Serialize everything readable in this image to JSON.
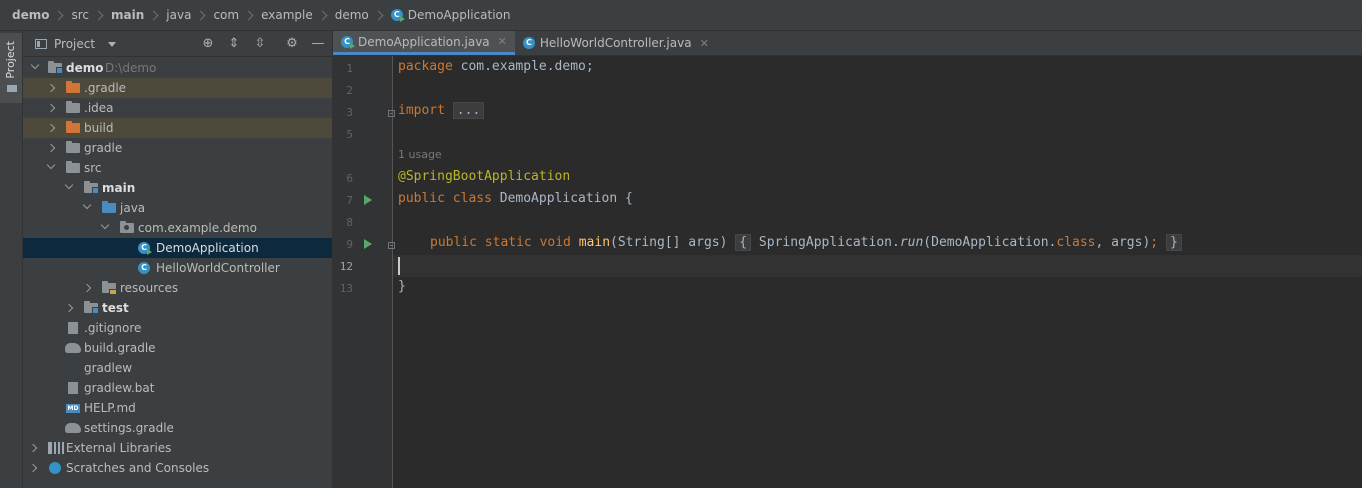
{
  "breadcrumb": [
    {
      "label": "demo",
      "bold": true
    },
    {
      "label": "src",
      "bold": false
    },
    {
      "label": "main",
      "bold": true
    },
    {
      "label": "java",
      "bold": false
    },
    {
      "label": "com",
      "bold": false
    },
    {
      "label": "example",
      "bold": false
    },
    {
      "label": "demo",
      "bold": false
    },
    {
      "label": "DemoApplication",
      "bold": false
    }
  ],
  "left_strip": {
    "label": "Project"
  },
  "project": {
    "title": "Project",
    "tree": [
      {
        "label": "demo",
        "path": "D:\\demo",
        "bold": true
      },
      {
        "label": ".gradle"
      },
      {
        "label": ".idea"
      },
      {
        "label": "build"
      },
      {
        "label": "gradle"
      },
      {
        "label": "src"
      },
      {
        "label": "main",
        "bold": true
      },
      {
        "label": "java"
      },
      {
        "label": "com.example.demo"
      },
      {
        "label": "DemoApplication"
      },
      {
        "label": "HelloWorldController"
      },
      {
        "label": "resources"
      },
      {
        "label": "test",
        "bold": true
      },
      {
        "label": ".gitignore"
      },
      {
        "label": "build.gradle"
      },
      {
        "label": "gradlew"
      },
      {
        "label": "gradlew.bat"
      },
      {
        "label": "HELP.md"
      },
      {
        "label": "settings.gradle"
      },
      {
        "label": "External Libraries"
      },
      {
        "label": "Scratches and Consoles"
      }
    ]
  },
  "tabs": [
    {
      "label": "DemoApplication.java",
      "active": true
    },
    {
      "label": "HelloWorldController.java",
      "active": false
    }
  ],
  "editor": {
    "line_numbers": [
      "1",
      "2",
      "3",
      "5",
      "6",
      "7",
      "8",
      "9",
      "12",
      "13"
    ],
    "usage_hint": "1 usage",
    "code": {
      "l1_kw": "package",
      "l1_rest": " com.example.demo;",
      "l3_kw": "import",
      "l3_fold": "...",
      "l6_ann": "@SpringBootApplication",
      "l7_kw": "public class",
      "l7_rest": " DemoApplication {",
      "l9_kw": "public static void",
      "l9_fn": "main",
      "l9_args": "(String[] args) ",
      "l9_open": "{",
      "l9_call": "SpringApplication.",
      "l9_run": "run",
      "l9_p1": "(DemoApplication.",
      "l9_class": "class",
      "l9_p2": ", args)",
      "l9_semi": ";",
      "l9_close": "}",
      "l13": "}"
    }
  }
}
